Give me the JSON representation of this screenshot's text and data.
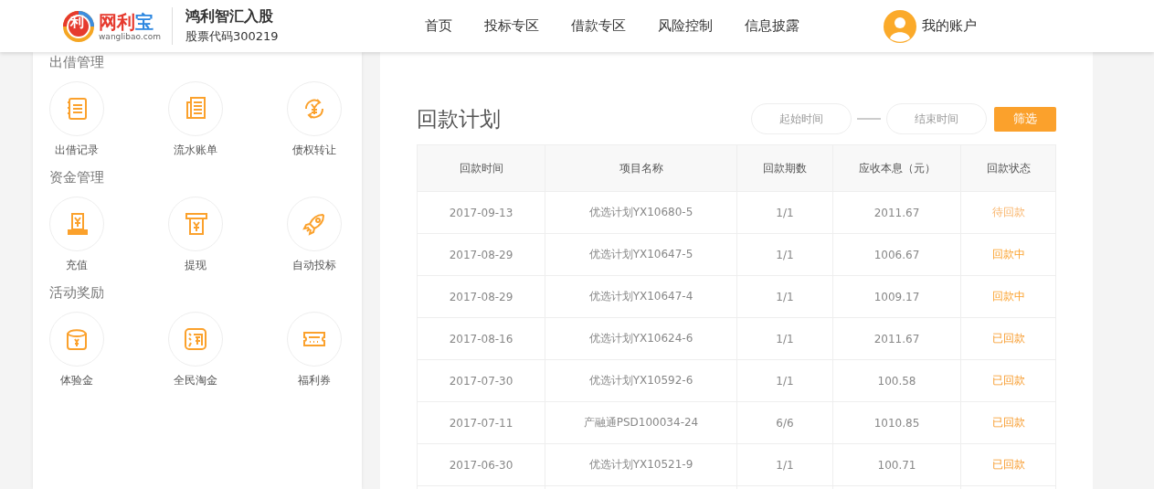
{
  "header": {
    "logo": {
      "badge": "利",
      "name_red": "网利",
      "name_blue": "宝",
      "domain": "wanglibao.com"
    },
    "slogan": "鸿利智汇入股",
    "stock_code": "股票代码300219",
    "nav": [
      {
        "label": "首页"
      },
      {
        "label": "投标专区"
      },
      {
        "label": "借款专区"
      },
      {
        "label": "风险控制"
      },
      {
        "label": "信息披露"
      }
    ],
    "account": "我的账户"
  },
  "sidebar": {
    "sections": [
      {
        "title": "出借管理",
        "items": [
          {
            "label": "出借记录",
            "kind": "notebook"
          },
          {
            "label": "流水账单",
            "kind": "document"
          },
          {
            "label": "债权转让",
            "kind": "transfer"
          }
        ]
      },
      {
        "title": "资金管理",
        "items": [
          {
            "label": "充值",
            "kind": "deposit"
          },
          {
            "label": "提现",
            "kind": "withdraw"
          },
          {
            "label": "自动投标",
            "kind": "rocket"
          }
        ]
      },
      {
        "title": "活动奖励",
        "items": [
          {
            "label": "体验金",
            "kind": "envelope"
          },
          {
            "label": "全民淘金",
            "kind": "tao"
          },
          {
            "label": "福利券",
            "kind": "ticket"
          }
        ]
      }
    ]
  },
  "main": {
    "title": "回款计划",
    "filter": {
      "start_placeholder": "起始时间",
      "end_placeholder": "结束时间",
      "button": "筛选"
    },
    "table": {
      "columns": [
        "回款时间",
        "项目名称",
        "回款期数",
        "应收本息（元）",
        "回款状态"
      ],
      "rows": [
        {
          "date": "2017-09-13",
          "project": "优选计划YX10680-5",
          "period": "1/1",
          "amount": "2011.67",
          "status": "待回款",
          "kind": "pending"
        },
        {
          "date": "2017-08-29",
          "project": "优选计划YX10647-5",
          "period": "1/1",
          "amount": "1006.67",
          "status": "回款中",
          "kind": "processing"
        },
        {
          "date": "2017-08-29",
          "project": "优选计划YX10647-4",
          "period": "1/1",
          "amount": "1009.17",
          "status": "回款中",
          "kind": "processing"
        },
        {
          "date": "2017-08-16",
          "project": "优选计划YX10624-6",
          "period": "1/1",
          "amount": "2011.67",
          "status": "已回款",
          "kind": "done"
        },
        {
          "date": "2017-07-30",
          "project": "优选计划YX10592-6",
          "period": "1/1",
          "amount": "100.58",
          "status": "已回款",
          "kind": "done"
        },
        {
          "date": "2017-07-11",
          "project": "产融通PSD100034-24",
          "period": "6/6",
          "amount": "1010.85",
          "status": "已回款",
          "kind": "done"
        },
        {
          "date": "2017-06-30",
          "project": "优选计划YX10521-9",
          "period": "1/1",
          "amount": "100.71",
          "status": "已回款",
          "kind": "done"
        }
      ]
    }
  }
}
